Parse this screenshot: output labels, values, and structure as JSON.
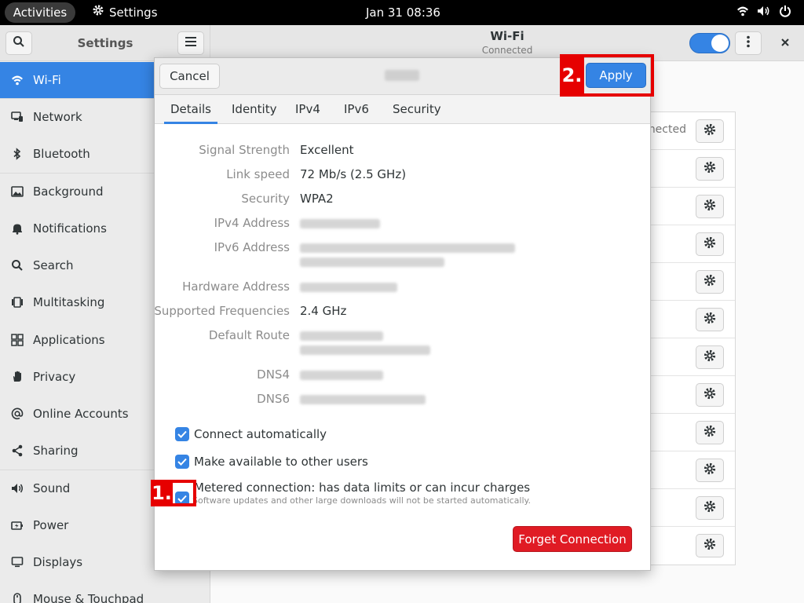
{
  "topbar": {
    "activities": "Activities",
    "app_name": "Settings",
    "clock": "Jan 31  08:36"
  },
  "sidebar": {
    "title": "Settings",
    "items": [
      {
        "label": "Wi-Fi",
        "icon": "wifi-icon",
        "active": true
      },
      {
        "label": "Network",
        "icon": "network-icon"
      },
      {
        "label": "Bluetooth",
        "icon": "bluetooth-icon"
      },
      {
        "label": "Background",
        "icon": "background-icon"
      },
      {
        "label": "Notifications",
        "icon": "bell-icon"
      },
      {
        "label": "Search",
        "icon": "search-icon"
      },
      {
        "label": "Multitasking",
        "icon": "multitasking-icon"
      },
      {
        "label": "Applications",
        "icon": "grid-icon"
      },
      {
        "label": "Privacy",
        "icon": "hand-icon"
      },
      {
        "label": "Online Accounts",
        "icon": "at-icon"
      },
      {
        "label": "Sharing",
        "icon": "share-icon"
      },
      {
        "label": "Sound",
        "icon": "speaker-icon"
      },
      {
        "label": "Power",
        "icon": "power-icon"
      },
      {
        "label": "Displays",
        "icon": "display-icon"
      },
      {
        "label": "Mouse & Touchpad",
        "icon": "mouse-icon"
      }
    ]
  },
  "main": {
    "title": "Wi-Fi",
    "subtitle": "Connected",
    "wifi_enabled": true,
    "connected_partial": "nected"
  },
  "dialog": {
    "cancel_label": "Cancel",
    "apply_label": "Apply",
    "tabs": [
      "Details",
      "Identity",
      "IPv4",
      "IPv6",
      "Security"
    ],
    "active_tab": "Details",
    "fields": {
      "signal_strength_label": "Signal Strength",
      "signal_strength_value": "Excellent",
      "link_speed_label": "Link speed",
      "link_speed_value": "72 Mb/s (2.5 GHz)",
      "security_label": "Security",
      "security_value": "WPA2",
      "ipv4_label": "IPv4 Address",
      "ipv6_label": "IPv6 Address",
      "hardware_label": "Hardware Address",
      "frequencies_label": "Supported Frequencies",
      "frequencies_value": "2.4 GHz",
      "route_label": "Default Route",
      "dns4_label": "DNS4",
      "dns6_label": "DNS6"
    },
    "checks": {
      "auto_connect": "Connect automatically",
      "available_users": "Make available to other users",
      "metered": "Metered connection: has data limits or can incur charges",
      "metered_sub": "Software updates and other large downloads will not be started automatically."
    },
    "forget_label": "Forget Connection"
  },
  "annotations": {
    "step1": "1.",
    "step2": "2."
  },
  "colors": {
    "accent": "#3584e4",
    "destructive": "#e01b24",
    "annotation": "#e60000"
  }
}
